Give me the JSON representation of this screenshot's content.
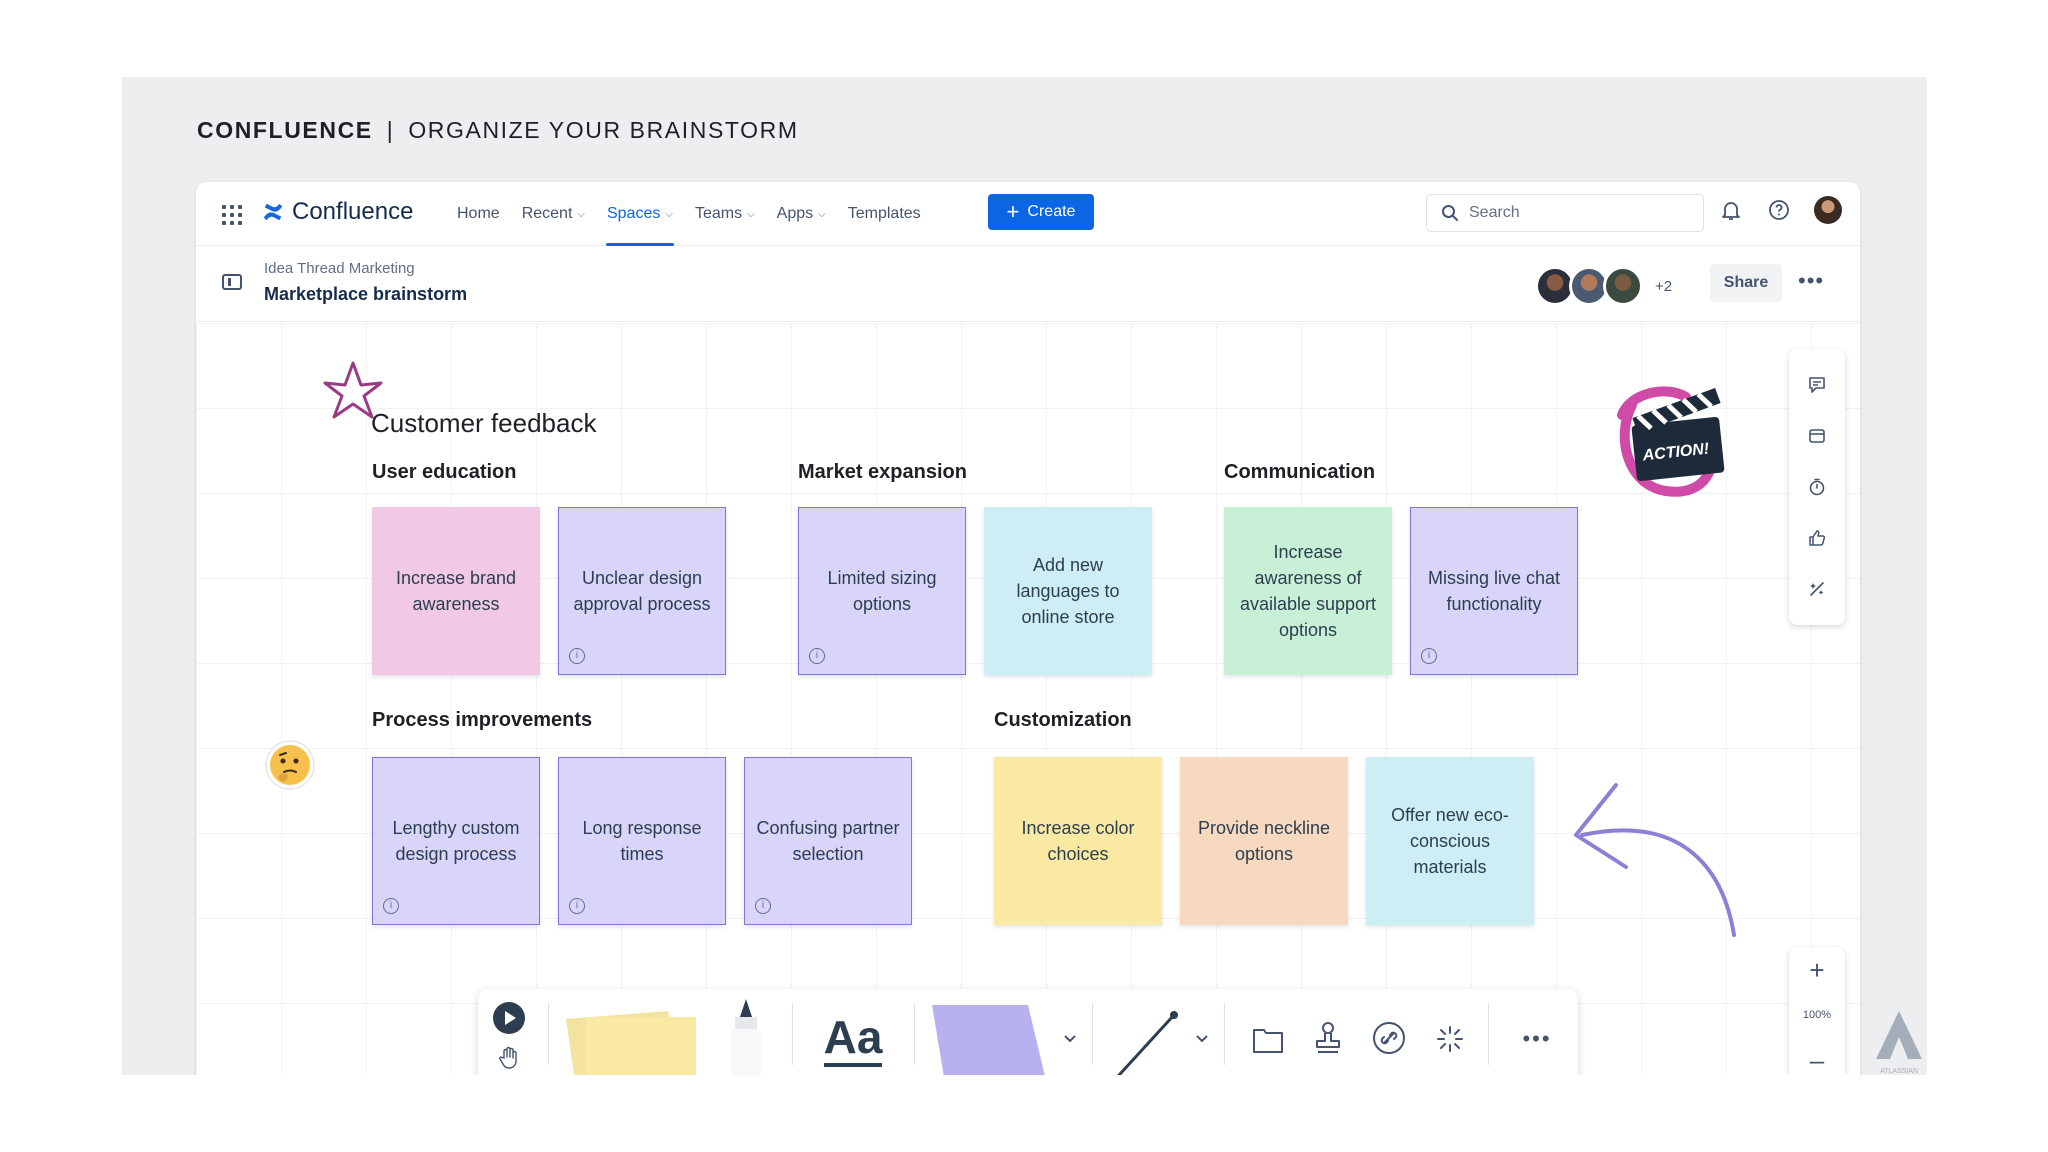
{
  "headline": {
    "brand": "CONFLUENCE",
    "separator": "|",
    "subtitle": "ORGANIZE YOUR BRAINSTORM"
  },
  "topnav": {
    "app_name": "Confluence",
    "items": [
      {
        "label": "Home",
        "has_chevron": false
      },
      {
        "label": "Recent",
        "has_chevron": true
      },
      {
        "label": "Spaces",
        "has_chevron": true,
        "active": true
      },
      {
        "label": "Teams",
        "has_chevron": true
      },
      {
        "label": "Apps",
        "has_chevron": true
      },
      {
        "label": "Templates",
        "has_chevron": false
      }
    ],
    "create_label": "Create",
    "search_placeholder": "Search"
  },
  "page": {
    "breadcrumb": "Idea Thread Marketing",
    "title": "Marketplace brainstorm",
    "collaborators_more": "+2",
    "share_label": "Share"
  },
  "canvas": {
    "title": "Customer feedback",
    "sections": {
      "user_education": {
        "title": "User education",
        "notes": [
          "Increase brand awareness",
          "Unclear design approval process"
        ]
      },
      "market_expansion": {
        "title": "Market expansion",
        "notes": [
          "Limited sizing options",
          "Add new languages to online store"
        ]
      },
      "communication": {
        "title": "Communication",
        "notes": [
          "Increase awareness of available support options",
          "Missing live chat functionality"
        ]
      },
      "process_improvements": {
        "title": "Process improvements",
        "notes": [
          "Lengthy custom design process",
          "Long response times",
          "Confusing partner selection"
        ]
      },
      "customization": {
        "title": "Customization",
        "notes": [
          "Increase color choices",
          "Provide neckline options",
          "Offer new eco-conscious materials"
        ]
      }
    },
    "sticker_text": "ACTION!",
    "zoom_level": "100%"
  },
  "toolbar": {
    "text_tool_label": "Aa"
  },
  "colors": {
    "accent": "#0c66e4",
    "pink_note": "#f1c9e4",
    "purple_note": "#d8d5f8",
    "cyan_note": "#cdeef5",
    "green_note": "#c8f0d7",
    "yellow_note": "#f9e9a3",
    "peach_note": "#f7d9bf",
    "arrow": "#8e7fd6",
    "star": "#9b3b86"
  }
}
